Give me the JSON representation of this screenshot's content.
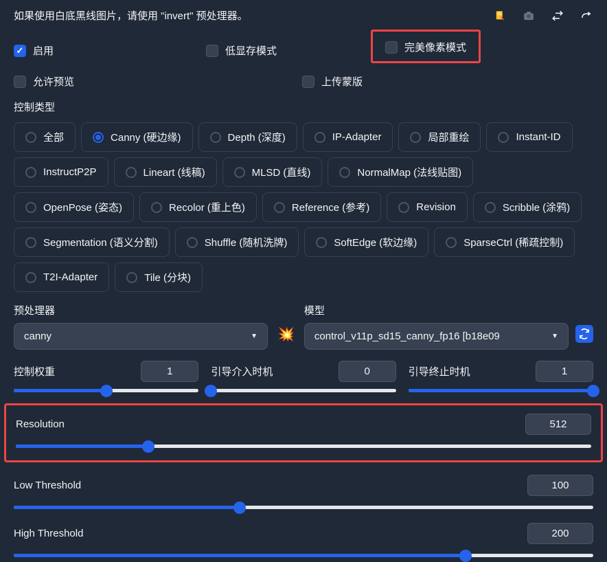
{
  "hint": "如果使用白底黑线图片，请使用 \"invert\" 预处理器。",
  "checkboxes": {
    "enable": {
      "label": "启用",
      "checked": true
    },
    "lowVram": {
      "label": "低显存模式",
      "checked": false
    },
    "pixelPerfect": {
      "label": "完美像素模式",
      "checked": false
    },
    "allowPreview": {
      "label": "允许预览",
      "checked": false
    },
    "uploadMask": {
      "label": "上传蒙版",
      "checked": false
    }
  },
  "controlTypeLabel": "控制类型",
  "controlTypes": [
    {
      "label": "全部",
      "selected": false
    },
    {
      "label": "Canny (硬边缘)",
      "selected": true
    },
    {
      "label": "Depth (深度)",
      "selected": false
    },
    {
      "label": "IP-Adapter",
      "selected": false
    },
    {
      "label": "局部重绘",
      "selected": false
    },
    {
      "label": "Instant-ID",
      "selected": false
    },
    {
      "label": "InstructP2P",
      "selected": false
    },
    {
      "label": "Lineart (线稿)",
      "selected": false
    },
    {
      "label": "MLSD (直线)",
      "selected": false
    },
    {
      "label": "NormalMap (法线贴图)",
      "selected": false
    },
    {
      "label": "OpenPose (姿态)",
      "selected": false
    },
    {
      "label": "Recolor (重上色)",
      "selected": false
    },
    {
      "label": "Reference (参考)",
      "selected": false
    },
    {
      "label": "Revision",
      "selected": false
    },
    {
      "label": "Scribble (涂鸦)",
      "selected": false
    },
    {
      "label": "Segmentation (语义分割)",
      "selected": false
    },
    {
      "label": "Shuffle (随机洗牌)",
      "selected": false
    },
    {
      "label": "SoftEdge (软边缘)",
      "selected": false
    },
    {
      "label": "SparseCtrl (稀疏控制)",
      "selected": false
    },
    {
      "label": "T2I-Adapter",
      "selected": false
    },
    {
      "label": "Tile (分块)",
      "selected": false
    }
  ],
  "preprocessor": {
    "label": "预处理器",
    "value": "canny"
  },
  "model": {
    "label": "模型",
    "value": "control_v11p_sd15_canny_fp16 [b18e09"
  },
  "sliders": {
    "controlWeight": {
      "label": "控制权重",
      "value": "1",
      "percent": 50
    },
    "guidanceStart": {
      "label": "引导介入时机",
      "value": "0",
      "percent": 0
    },
    "guidanceEnd": {
      "label": "引导终止时机",
      "value": "1",
      "percent": 100
    },
    "resolution": {
      "label": "Resolution",
      "value": "512",
      "percent": 23
    },
    "lowThreshold": {
      "label": "Low Threshold",
      "value": "100",
      "percent": 39
    },
    "highThreshold": {
      "label": "High Threshold",
      "value": "200",
      "percent": 78
    }
  }
}
